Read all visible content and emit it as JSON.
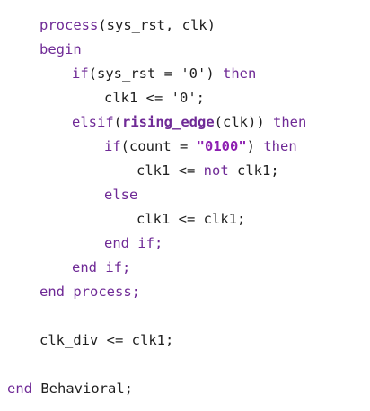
{
  "code": {
    "lines": [
      {
        "indent": 1,
        "segments": [
          {
            "t": "process",
            "k": "kw"
          },
          {
            "t": "(sys_rst, clk)",
            "k": "plain"
          }
        ]
      },
      {
        "indent": 1,
        "segments": [
          {
            "t": "begin",
            "k": "kw"
          }
        ]
      },
      {
        "indent": 2,
        "segments": [
          {
            "t": "if",
            "k": "kw"
          },
          {
            "t": "(sys_rst = '0') ",
            "k": "plain"
          },
          {
            "t": "then",
            "k": "kw"
          }
        ]
      },
      {
        "indent": 3,
        "segments": [
          {
            "t": "clk1 <= '0';",
            "k": "plain"
          }
        ]
      },
      {
        "indent": 2,
        "segments": [
          {
            "t": "elsif",
            "k": "kw"
          },
          {
            "t": "(",
            "k": "plain"
          },
          {
            "t": "rising_edge",
            "k": "bold-kw"
          },
          {
            "t": "(clk)) ",
            "k": "plain"
          },
          {
            "t": "then",
            "k": "kw"
          }
        ]
      },
      {
        "indent": 3,
        "segments": [
          {
            "t": "if",
            "k": "kw"
          },
          {
            "t": "(count = ",
            "k": "plain"
          },
          {
            "t": "\"0100\"",
            "k": "str"
          },
          {
            "t": ") ",
            "k": "plain"
          },
          {
            "t": "then",
            "k": "kw"
          }
        ]
      },
      {
        "indent": 4,
        "segments": [
          {
            "t": "clk1 <= ",
            "k": "plain"
          },
          {
            "t": "not",
            "k": "kw"
          },
          {
            "t": " clk1;",
            "k": "plain"
          }
        ]
      },
      {
        "indent": 3,
        "segments": [
          {
            "t": "else",
            "k": "kw"
          }
        ]
      },
      {
        "indent": 4,
        "segments": [
          {
            "t": "clk1 <= clk1;",
            "k": "plain"
          }
        ]
      },
      {
        "indent": 3,
        "segments": [
          {
            "t": "end if;",
            "k": "kw"
          }
        ]
      },
      {
        "indent": 2,
        "segments": [
          {
            "t": "end if;",
            "k": "kw"
          }
        ]
      },
      {
        "indent": 1,
        "segments": [
          {
            "t": "end process;",
            "k": "kw"
          }
        ]
      },
      {
        "indent": 0,
        "segments": []
      },
      {
        "indent": 1,
        "segments": [
          {
            "t": "clk_div <= clk1;",
            "k": "plain"
          }
        ]
      },
      {
        "indent": 0,
        "segments": []
      },
      {
        "indent": 0,
        "segments": [
          {
            "t": "end",
            "k": "kw"
          },
          {
            "t": " Behavioral;",
            "k": "plain"
          }
        ]
      }
    ]
  }
}
